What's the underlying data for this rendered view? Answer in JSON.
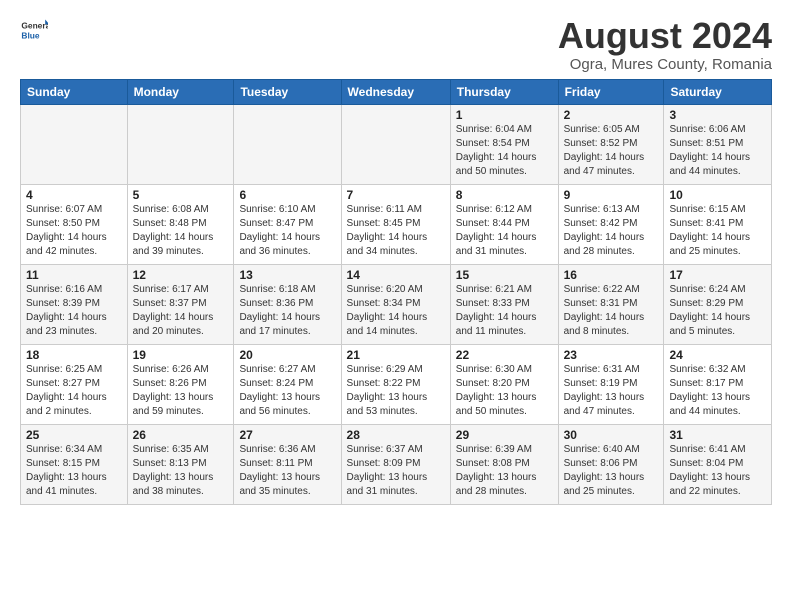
{
  "logo": {
    "general": "General",
    "blue": "Blue"
  },
  "title": {
    "month_year": "August 2024",
    "location": "Ogra, Mures County, Romania"
  },
  "weekdays": [
    "Sunday",
    "Monday",
    "Tuesday",
    "Wednesday",
    "Thursday",
    "Friday",
    "Saturday"
  ],
  "weeks": [
    [
      {
        "day": "",
        "info": ""
      },
      {
        "day": "",
        "info": ""
      },
      {
        "day": "",
        "info": ""
      },
      {
        "day": "",
        "info": ""
      },
      {
        "day": "1",
        "sunrise": "6:04 AM",
        "sunset": "8:54 PM",
        "daylight": "14 hours and 50 minutes."
      },
      {
        "day": "2",
        "sunrise": "6:05 AM",
        "sunset": "8:52 PM",
        "daylight": "14 hours and 47 minutes."
      },
      {
        "day": "3",
        "sunrise": "6:06 AM",
        "sunset": "8:51 PM",
        "daylight": "14 hours and 44 minutes."
      }
    ],
    [
      {
        "day": "4",
        "sunrise": "6:07 AM",
        "sunset": "8:50 PM",
        "daylight": "14 hours and 42 minutes."
      },
      {
        "day": "5",
        "sunrise": "6:08 AM",
        "sunset": "8:48 PM",
        "daylight": "14 hours and 39 minutes."
      },
      {
        "day": "6",
        "sunrise": "6:10 AM",
        "sunset": "8:47 PM",
        "daylight": "14 hours and 36 minutes."
      },
      {
        "day": "7",
        "sunrise": "6:11 AM",
        "sunset": "8:45 PM",
        "daylight": "14 hours and 34 minutes."
      },
      {
        "day": "8",
        "sunrise": "6:12 AM",
        "sunset": "8:44 PM",
        "daylight": "14 hours and 31 minutes."
      },
      {
        "day": "9",
        "sunrise": "6:13 AM",
        "sunset": "8:42 PM",
        "daylight": "14 hours and 28 minutes."
      },
      {
        "day": "10",
        "sunrise": "6:15 AM",
        "sunset": "8:41 PM",
        "daylight": "14 hours and 25 minutes."
      }
    ],
    [
      {
        "day": "11",
        "sunrise": "6:16 AM",
        "sunset": "8:39 PM",
        "daylight": "14 hours and 23 minutes."
      },
      {
        "day": "12",
        "sunrise": "6:17 AM",
        "sunset": "8:37 PM",
        "daylight": "14 hours and 20 minutes."
      },
      {
        "day": "13",
        "sunrise": "6:18 AM",
        "sunset": "8:36 PM",
        "daylight": "14 hours and 17 minutes."
      },
      {
        "day": "14",
        "sunrise": "6:20 AM",
        "sunset": "8:34 PM",
        "daylight": "14 hours and 14 minutes."
      },
      {
        "day": "15",
        "sunrise": "6:21 AM",
        "sunset": "8:33 PM",
        "daylight": "14 hours and 11 minutes."
      },
      {
        "day": "16",
        "sunrise": "6:22 AM",
        "sunset": "8:31 PM",
        "daylight": "14 hours and 8 minutes."
      },
      {
        "day": "17",
        "sunrise": "6:24 AM",
        "sunset": "8:29 PM",
        "daylight": "14 hours and 5 minutes."
      }
    ],
    [
      {
        "day": "18",
        "sunrise": "6:25 AM",
        "sunset": "8:27 PM",
        "daylight": "14 hours and 2 minutes."
      },
      {
        "day": "19",
        "sunrise": "6:26 AM",
        "sunset": "8:26 PM",
        "daylight": "13 hours and 59 minutes."
      },
      {
        "day": "20",
        "sunrise": "6:27 AM",
        "sunset": "8:24 PM",
        "daylight": "13 hours and 56 minutes."
      },
      {
        "day": "21",
        "sunrise": "6:29 AM",
        "sunset": "8:22 PM",
        "daylight": "13 hours and 53 minutes."
      },
      {
        "day": "22",
        "sunrise": "6:30 AM",
        "sunset": "8:20 PM",
        "daylight": "13 hours and 50 minutes."
      },
      {
        "day": "23",
        "sunrise": "6:31 AM",
        "sunset": "8:19 PM",
        "daylight": "13 hours and 47 minutes."
      },
      {
        "day": "24",
        "sunrise": "6:32 AM",
        "sunset": "8:17 PM",
        "daylight": "13 hours and 44 minutes."
      }
    ],
    [
      {
        "day": "25",
        "sunrise": "6:34 AM",
        "sunset": "8:15 PM",
        "daylight": "13 hours and 41 minutes."
      },
      {
        "day": "26",
        "sunrise": "6:35 AM",
        "sunset": "8:13 PM",
        "daylight": "13 hours and 38 minutes."
      },
      {
        "day": "27",
        "sunrise": "6:36 AM",
        "sunset": "8:11 PM",
        "daylight": "13 hours and 35 minutes."
      },
      {
        "day": "28",
        "sunrise": "6:37 AM",
        "sunset": "8:09 PM",
        "daylight": "13 hours and 31 minutes."
      },
      {
        "day": "29",
        "sunrise": "6:39 AM",
        "sunset": "8:08 PM",
        "daylight": "13 hours and 28 minutes."
      },
      {
        "day": "30",
        "sunrise": "6:40 AM",
        "sunset": "8:06 PM",
        "daylight": "13 hours and 25 minutes."
      },
      {
        "day": "31",
        "sunrise": "6:41 AM",
        "sunset": "8:04 PM",
        "daylight": "13 hours and 22 minutes."
      }
    ]
  ],
  "labels": {
    "sunrise": "Sunrise:",
    "sunset": "Sunset:",
    "daylight": "Daylight:"
  }
}
